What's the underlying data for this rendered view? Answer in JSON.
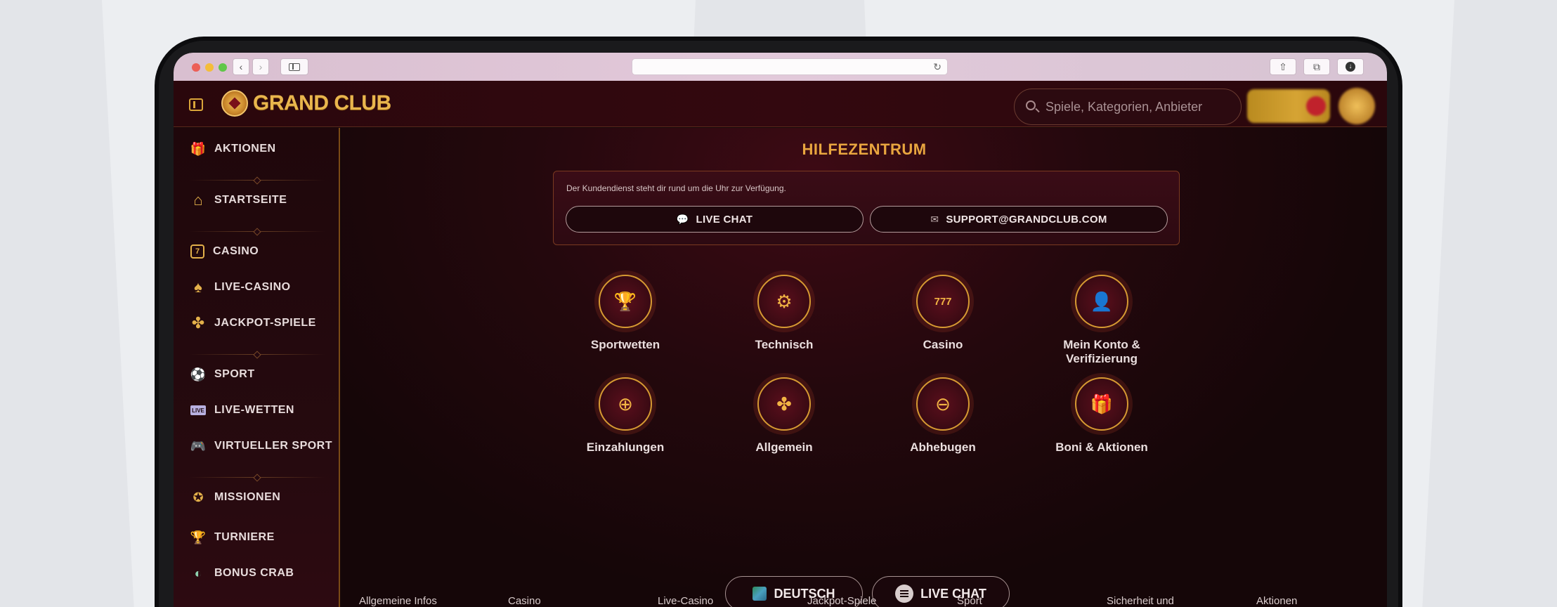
{
  "browser": {
    "back_icon": "‹",
    "forward_icon": "›",
    "sidebar_icon": "sidebar-icon",
    "reload_icon": "↻",
    "share_icon": "⇧",
    "tabs_icon": "⧉",
    "download_icon": "↓"
  },
  "header": {
    "logo_text": "GRAND CLUB",
    "search_placeholder": "Spiele, Kategorien, Anbieter"
  },
  "sidebar": {
    "items": [
      {
        "label": "AKTIONEN",
        "icon": "🎁"
      },
      {
        "label": "STARTSEITE",
        "icon": "⌂"
      },
      {
        "label": "CASINO",
        "icon": "7"
      },
      {
        "label": "LIVE-CASINO",
        "icon": "♠"
      },
      {
        "label": "JACKPOT-SPIELE",
        "icon": "✤"
      },
      {
        "label": "SPORT",
        "icon": "⚽"
      },
      {
        "label": "LIVE-WETTEN",
        "icon": "LIVE"
      },
      {
        "label": "VIRTUELLER SPORT",
        "icon": "🎮"
      },
      {
        "label": "MISSIONEN",
        "icon": "✪"
      },
      {
        "label": "TURNIERE",
        "icon": "🏆"
      },
      {
        "label": "BONUS CRAB",
        "icon": "◐"
      }
    ]
  },
  "main": {
    "title": "HILFEZENTRUM",
    "support_text": "Der Kundendienst steht dir rund um die Uhr zur Verfügung.",
    "live_chat_label": "LIVE CHAT",
    "email_label": "SUPPORT@GRANDCLUB.COM",
    "categories": [
      {
        "label": "Sportwetten",
        "icon": "🏆"
      },
      {
        "label": "Technisch",
        "icon": "⚙"
      },
      {
        "label": "Casino",
        "icon": "777"
      },
      {
        "label": "Mein Konto &\nVerifizierung",
        "icon": "👤"
      },
      {
        "label": "Einzahlungen",
        "icon": "⊕"
      },
      {
        "label": "Allgemein",
        "icon": "✤"
      },
      {
        "label": "Abhebugen",
        "icon": "⊖"
      },
      {
        "label": "Boni & Aktionen",
        "icon": "🎁"
      }
    ],
    "language_label": "DEUTSCH",
    "bottom_chat_label": "LIVE CHAT"
  },
  "footer": {
    "links": [
      "Allgemeine Infos",
      "Casino",
      "Live-Casino",
      "Jackpot-Spiele",
      "Sport",
      "Sicherheit und",
      "Aktionen"
    ]
  },
  "colors": {
    "accent_gold": "#e3b04a",
    "background": "#160709",
    "title_orange": "#e9a63f"
  }
}
